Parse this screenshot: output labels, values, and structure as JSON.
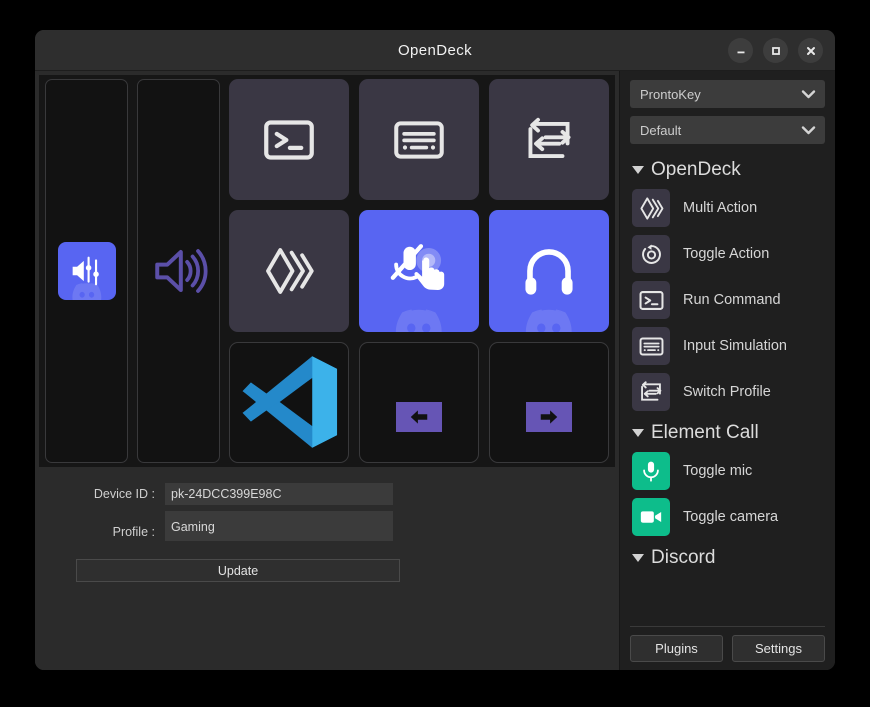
{
  "window": {
    "title": "OpenDeck",
    "controls": [
      {
        "name": "minimize-button",
        "glyph": "minimize-icon"
      },
      {
        "name": "maximize-button",
        "glyph": "maximize-icon"
      },
      {
        "name": "close-button",
        "glyph": "close-icon"
      }
    ]
  },
  "colors": {
    "discord_blurple": "#5865F2",
    "element_green": "#0dbd8b",
    "key_dark": "#3a3744",
    "arrow_purple": "#6655b5",
    "deck_background": "#161616",
    "window_background": "#2b2b2b",
    "sidebar_background": "#1f1f1f"
  },
  "deck": {
    "sliders": [
      {
        "name": "slider-discord-volume-mixer",
        "icon": "discord-volume-mixer-icon",
        "filled": true
      },
      {
        "name": "slider-volume",
        "icon": "volume-speaker-icon",
        "filled": false
      }
    ],
    "keys": [
      {
        "name": "key-run-command",
        "icon": "terminal-icon",
        "style": "dark"
      },
      {
        "name": "key-input-simulation",
        "icon": "keyboard-icon",
        "style": "dark"
      },
      {
        "name": "key-switch-profile",
        "icon": "switch-profile-icon",
        "style": "dark"
      },
      {
        "name": "key-multi-action",
        "icon": "multi-action-icon",
        "style": "dark"
      },
      {
        "name": "key-push-to-talk",
        "icon": "mic-muted-hand-icon",
        "style": "blurple"
      },
      {
        "name": "key-deafen",
        "icon": "headphones-icon",
        "style": "blurple"
      },
      {
        "name": "key-vscode",
        "icon": "vscode-icon",
        "style": "empty"
      },
      {
        "name": "key-previous-page",
        "icon": "arrow-left-icon",
        "style": "empty"
      },
      {
        "name": "key-next-page",
        "icon": "arrow-right-icon",
        "style": "empty"
      }
    ]
  },
  "form": {
    "device_id_label": "Device ID :",
    "device_id_value": "pk-24DCC399E98C",
    "profile_label": "Profile :",
    "profile_value": "Gaming",
    "update_label": "Update"
  },
  "sidebar": {
    "device_select": {
      "value": "ProntoKey"
    },
    "profile_select": {
      "value": "Default"
    },
    "sections": [
      {
        "title": "OpenDeck",
        "expanded": true,
        "actions": [
          {
            "label": "Multi Action",
            "icon": "multi-action-icon",
            "accent": "dark"
          },
          {
            "label": "Toggle Action",
            "icon": "toggle-action-icon",
            "accent": "dark"
          },
          {
            "label": "Run Command",
            "icon": "terminal-icon",
            "accent": "dark"
          },
          {
            "label": "Input Simulation",
            "icon": "keyboard-icon",
            "accent": "dark"
          },
          {
            "label": "Switch Profile",
            "icon": "switch-profile-icon",
            "accent": "dark"
          }
        ]
      },
      {
        "title": "Element Call",
        "expanded": true,
        "actions": [
          {
            "label": "Toggle mic",
            "icon": "microphone-icon",
            "accent": "green"
          },
          {
            "label": "Toggle camera",
            "icon": "camera-icon",
            "accent": "green"
          }
        ]
      },
      {
        "title": "Discord",
        "expanded": true,
        "actions": []
      }
    ],
    "footer": {
      "plugins_label": "Plugins",
      "settings_label": "Settings"
    }
  }
}
